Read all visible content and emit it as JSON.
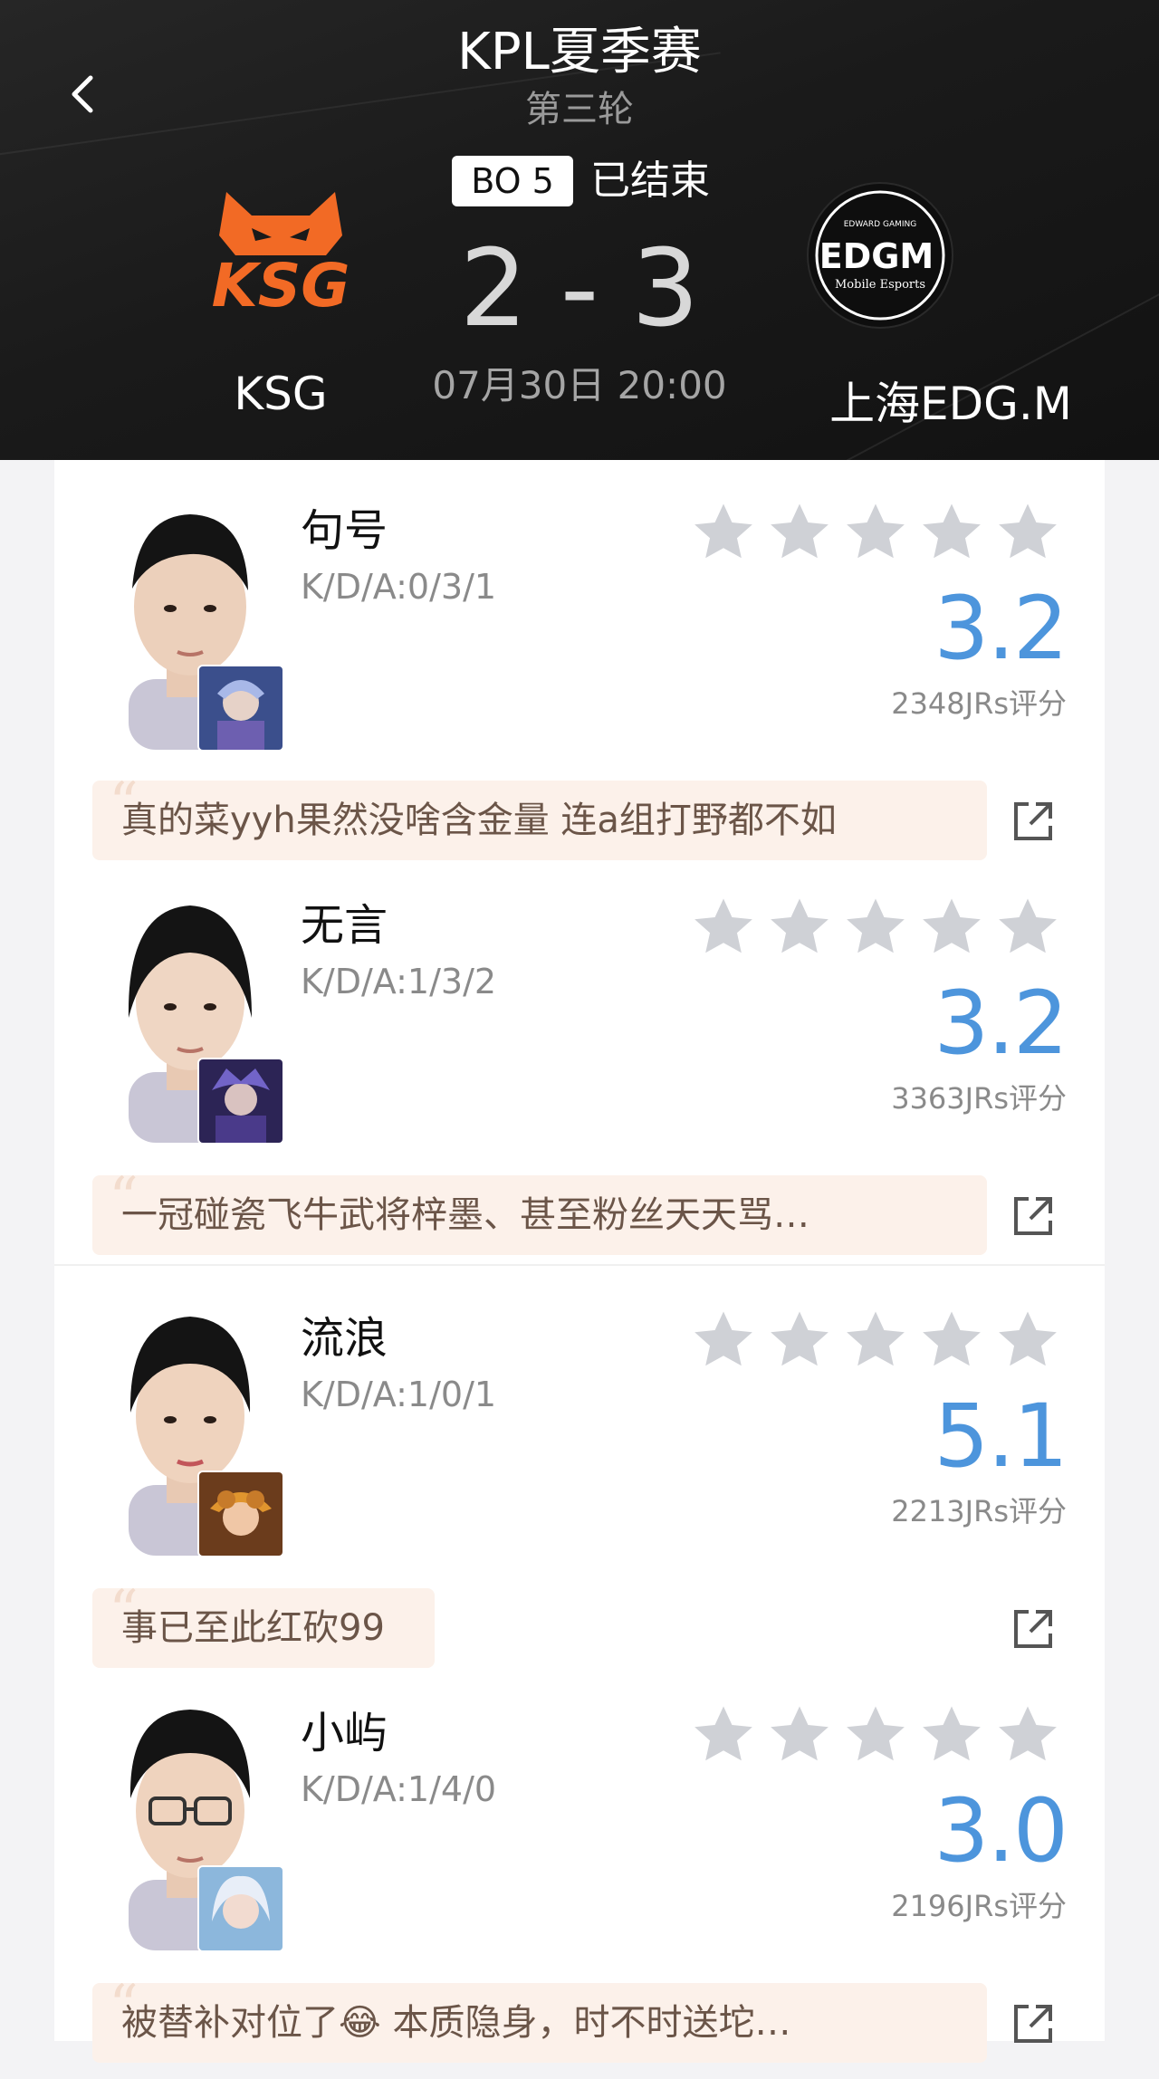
{
  "header": {
    "title": "KPL夏季赛",
    "round": "第三轮",
    "bo": "BO 5",
    "status": "已结束",
    "score_left": "2",
    "score_sep": "-",
    "score_right": "3",
    "time": "07月30日 20:00",
    "team_left": "KSG",
    "team_right": "上海EDG.M",
    "logo_left_text": "KSG",
    "logo_right_text": "EDGM",
    "logo_right_top": "EDWARD GAMING",
    "logo_right_sub": "Mobile Esports"
  },
  "colors": {
    "accent_blue": "#4d95dc",
    "ksg_orange": "#f26a25",
    "edg_red": "#d9262c",
    "star_gray": "#cfd1d6"
  },
  "players": [
    {
      "name": "句号",
      "kda": "K/D/A:0/3/1",
      "rating": "3.2",
      "rating_count": "2348JRs评分",
      "comment": "真的菜yyh果然没啥含金量 连a组打野都不如",
      "stars_filled": 0
    },
    {
      "name": "无言",
      "kda": "K/D/A:1/3/2",
      "rating": "3.2",
      "rating_count": "3363JRs评分",
      "comment": "一冠碰瓷飞牛武将梓墨、甚至粉丝天天骂…",
      "stars_filled": 0
    },
    {
      "name": "流浪",
      "kda": "K/D/A:1/0/1",
      "rating": "5.1",
      "rating_count": "2213JRs评分",
      "comment": "事已至此红砍99",
      "stars_filled": 0
    },
    {
      "name": "小屿",
      "kda": "K/D/A:1/4/0",
      "rating": "3.0",
      "rating_count": "2196JRs评分",
      "comment": "被替补对位了😂 本质隐身，时不时送坨…",
      "stars_filled": 0
    }
  ],
  "icons": {
    "back": "chevron-left-icon",
    "star": "star-icon",
    "share": "share-external-icon"
  }
}
